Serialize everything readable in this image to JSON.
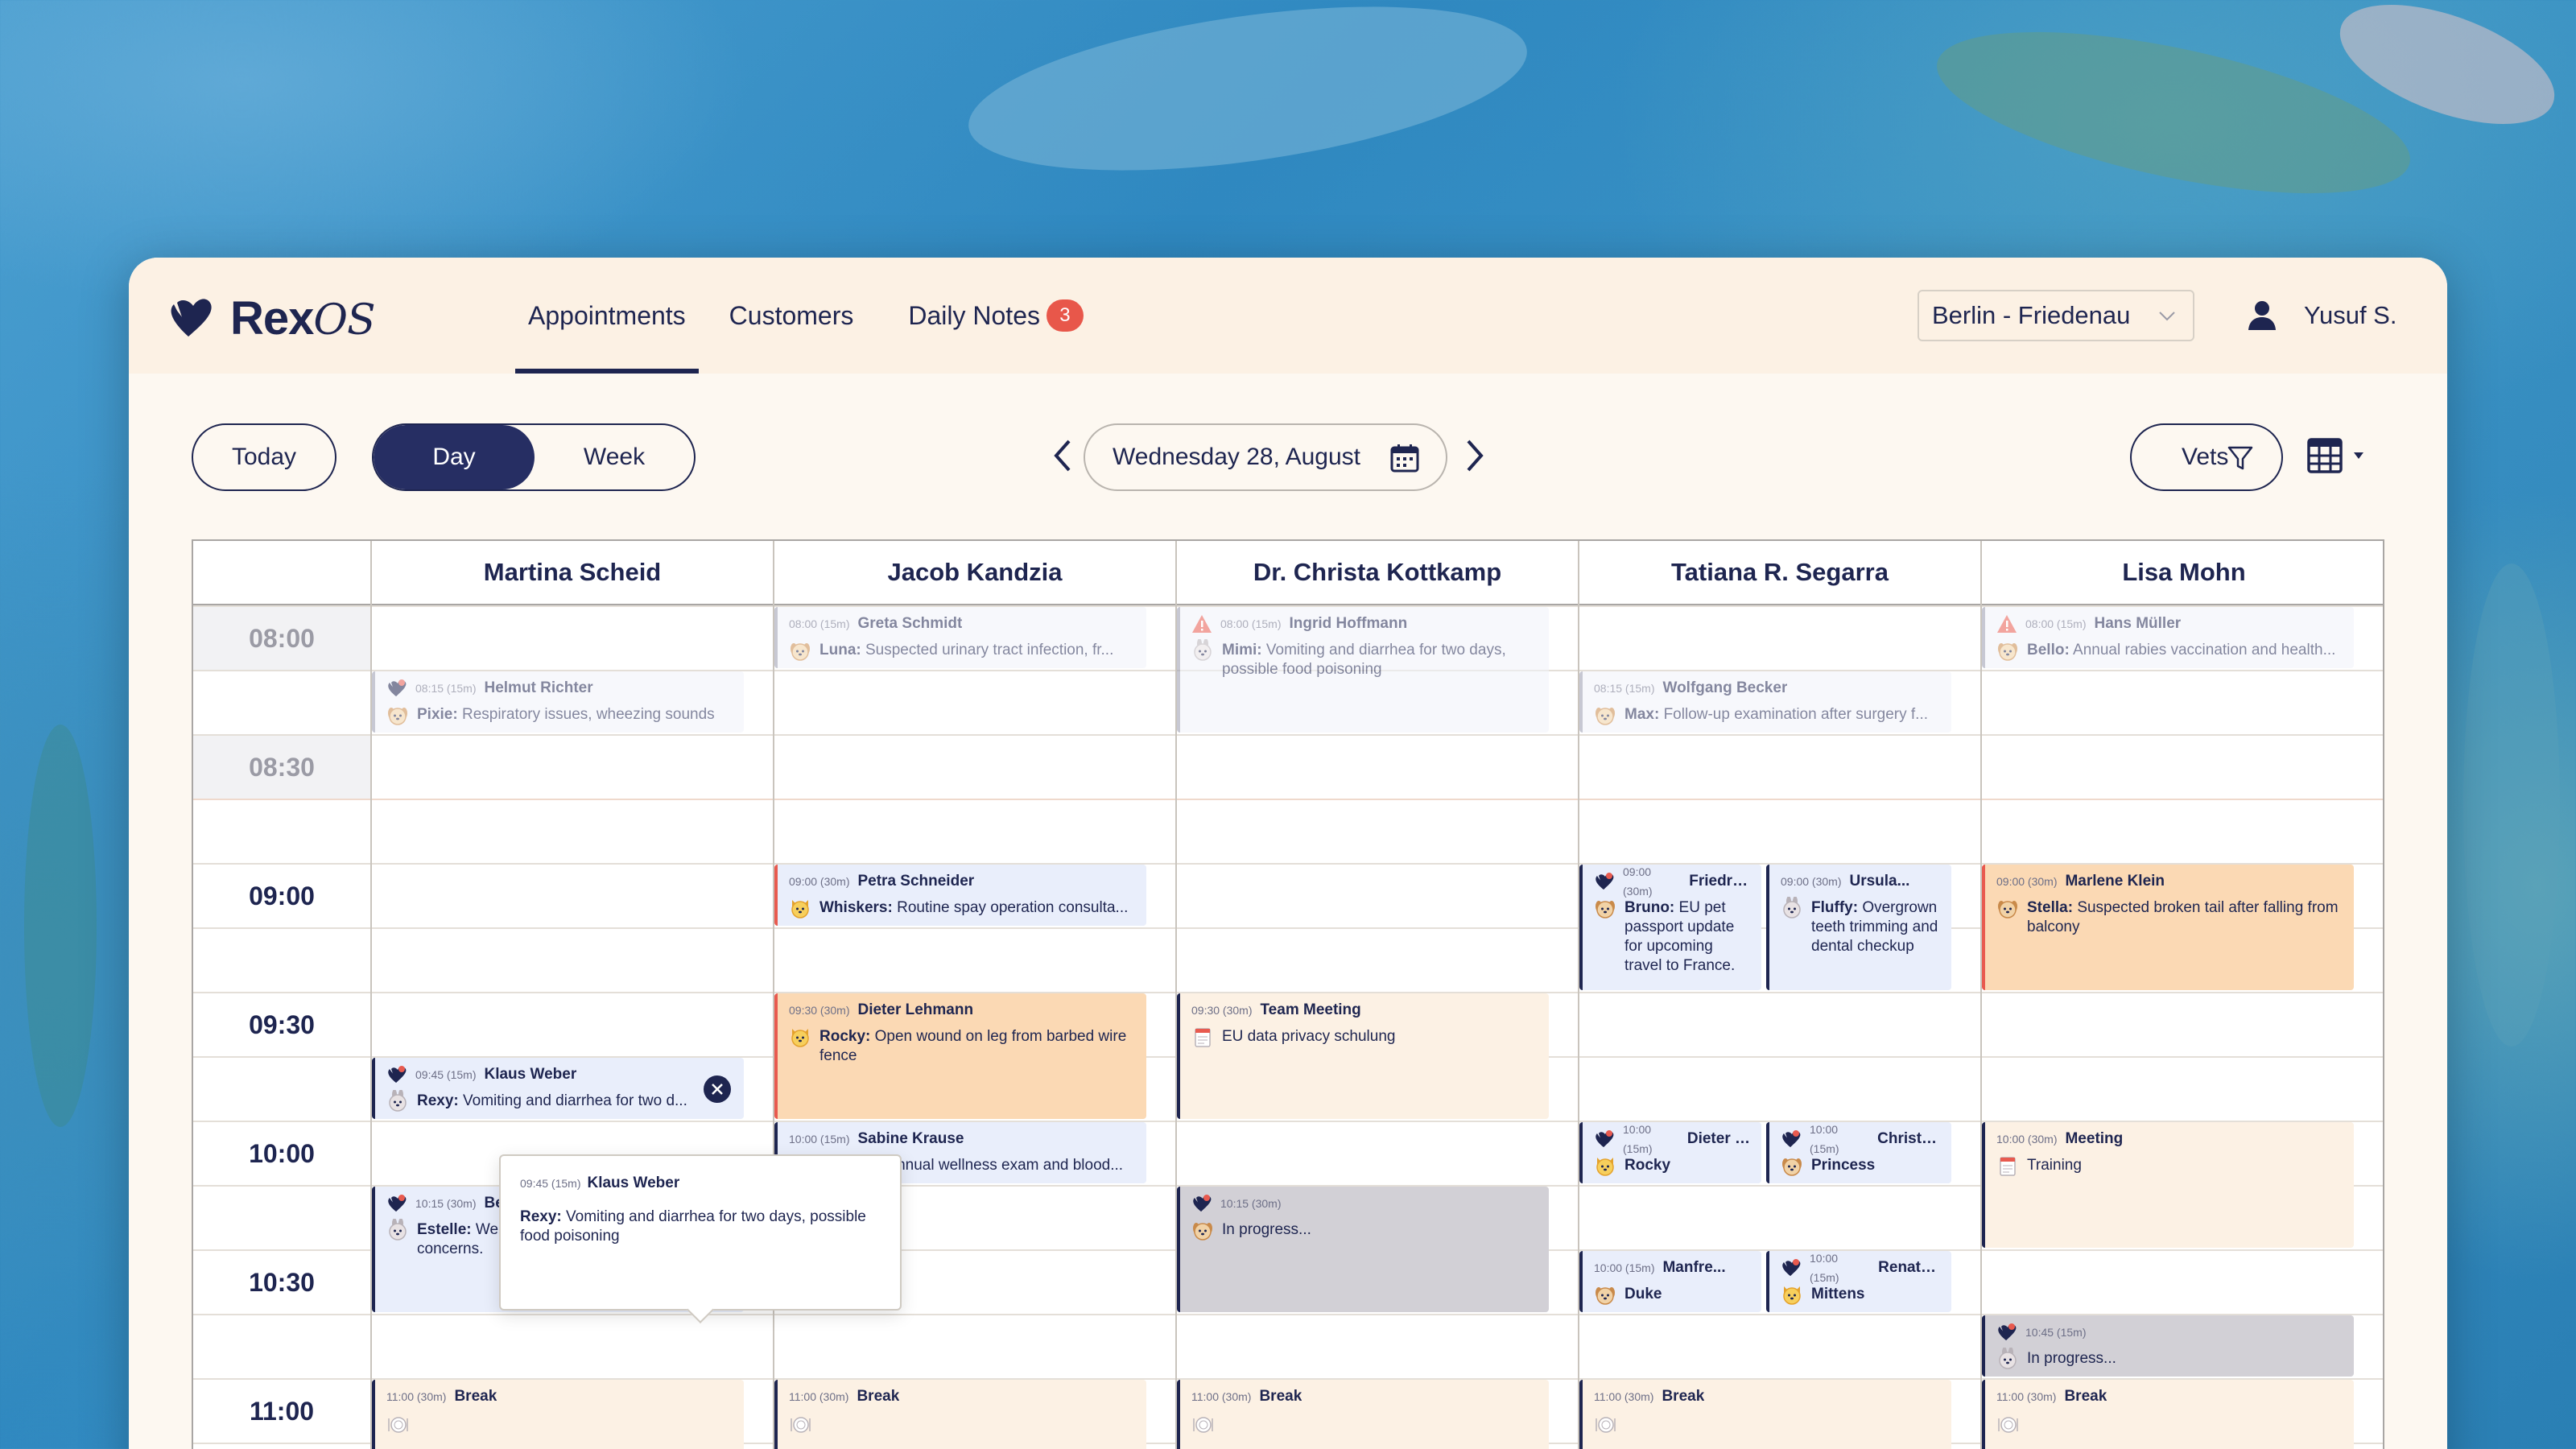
{
  "app": {
    "name": "Rex",
    "name_italic": "OS"
  },
  "nav": [
    {
      "label": "Appointments",
      "active": true
    },
    {
      "label": "Customers"
    },
    {
      "label": "Daily Notes",
      "badge": "3"
    }
  ],
  "location": "Berlin - Friedenau",
  "user": "Yusuf S.",
  "toolbar": {
    "today": "Today",
    "day": "Day",
    "week": "Week",
    "date": "Wednesday 28, August",
    "vets": "Vets"
  },
  "vets": [
    "Martina Scheid",
    "Jacob Kandzia",
    "Dr. Christa Kottkamp",
    "Tatiana R. Segarra",
    "Lisa Mohn"
  ],
  "times": [
    "08:00",
    "08:30",
    "09:00",
    "09:30",
    "10:00",
    "10:30",
    "11:00"
  ],
  "popover": {
    "time": "09:45 (15m)",
    "owner": "Klaus Weber",
    "pet": "Rexy:",
    "reason": "Vomiting and diarrhea for two days, possible food poisoning"
  },
  "appointments": [
    {
      "id": "a1",
      "time": "08:15 (15m)",
      "owner": "Helmut Richter",
      "pet": "Pixie:",
      "reason": "Respiratory issues, wheezing sounds"
    },
    {
      "id": "a2",
      "time": "09:45 (15m)",
      "owner": "Klaus Weber",
      "pet": "Rexy:",
      "reason": "Vomiting and diarrhea for two d..."
    },
    {
      "id": "a3",
      "time": "10:15 (30m)",
      "owner": "Bernd Schulz",
      "pet": "Estelle:",
      "reason": "Weight loss and decreased appetite concerns."
    },
    {
      "id": "a4",
      "time": "11:00 (30m)",
      "owner": "Break",
      "pet": "",
      "reason": ""
    },
    {
      "id": "b1",
      "time": "08:00 (15m)",
      "owner": "Greta Schmidt",
      "pet": "Luna:",
      "reason": "Suspected urinary tract infection, fr..."
    },
    {
      "id": "b2",
      "time": "09:00 (30m)",
      "owner": "Petra Schneider",
      "pet": "Whiskers:",
      "reason": "Routine spay operation consulta..."
    },
    {
      "id": "b3",
      "time": "09:30 (30m)",
      "owner": "Dieter Lehmann",
      "pet": "Rocky:",
      "reason": "Open wound on leg from barbed wire fence"
    },
    {
      "id": "b4",
      "time": "10:00 (15m)",
      "owner": "Sabine Krause",
      "pet": "Smokey:",
      "reason": "Annual wellness exam and blood..."
    },
    {
      "id": "b5",
      "time": "11:00 (30m)",
      "owner": "Break",
      "pet": "",
      "reason": ""
    },
    {
      "id": "c1",
      "time": "08:00 (15m)",
      "owner": "Ingrid Hoffmann",
      "pet": "Mimi:",
      "reason": "Vomiting and diarrhea for two days, possible food poisoning"
    },
    {
      "id": "c2",
      "time": "09:30 (30m)",
      "owner": "Team Meeting",
      "pet": "",
      "reason": "EU data privacy schulung"
    },
    {
      "id": "c3",
      "time": "10:15 (30m)",
      "owner": "",
      "pet": "",
      "reason": "In progress..."
    },
    {
      "id": "c4",
      "time": "11:00 (30m)",
      "owner": "Break",
      "pet": "",
      "reason": ""
    },
    {
      "id": "d1",
      "time": "08:15 (15m)",
      "owner": "Wolfgang Becker",
      "pet": "Max:",
      "reason": "Follow-up examination after surgery f..."
    },
    {
      "id": "d2",
      "time": "09:00 (30m)",
      "owner": "Friedrich",
      "pet": "Bruno:",
      "reason": "EU pet passport update for upcoming travel to France."
    },
    {
      "id": "d3",
      "time": "09:00 (30m)",
      "owner": "Ursula...",
      "pet": "Fluffy:",
      "reason": "Overgrown teeth trimming and dental checkup"
    },
    {
      "id": "d4",
      "time": "10:00 (15m)",
      "owner": "Dieter L...",
      "pet": "Rocky",
      "reason": ""
    },
    {
      "id": "d5",
      "time": "10:00 (15m)",
      "owner": "Christa...",
      "pet": "Princess",
      "reason": ""
    },
    {
      "id": "d6",
      "time": "10:00 (15m)",
      "owner": "Manfre...",
      "pet": "Duke",
      "reason": ""
    },
    {
      "id": "d7",
      "time": "10:00 (15m)",
      "owner": "Renate...",
      "pet": "Mittens",
      "reason": ""
    },
    {
      "id": "d8",
      "time": "11:00 (30m)",
      "owner": "Break",
      "pet": "",
      "reason": ""
    },
    {
      "id": "e1",
      "time": "08:00 (15m)",
      "owner": "Hans Müller",
      "pet": "Bello:",
      "reason": "Annual rabies vaccination and health..."
    },
    {
      "id": "e2",
      "time": "09:00 (30m)",
      "owner": "Marlene Klein",
      "pet": "Stella:",
      "reason": "Suspected broken tail after falling from balcony"
    },
    {
      "id": "e3",
      "time": "10:00 (30m)",
      "owner": "Meeting",
      "pet": "",
      "reason": "Training"
    },
    {
      "id": "e4",
      "time": "10:45 (15m)",
      "owner": "",
      "pet": "",
      "reason": "In progress..."
    },
    {
      "id": "e5",
      "time": "11:00 (30m)",
      "owner": "Break",
      "pet": "",
      "reason": ""
    }
  ]
}
